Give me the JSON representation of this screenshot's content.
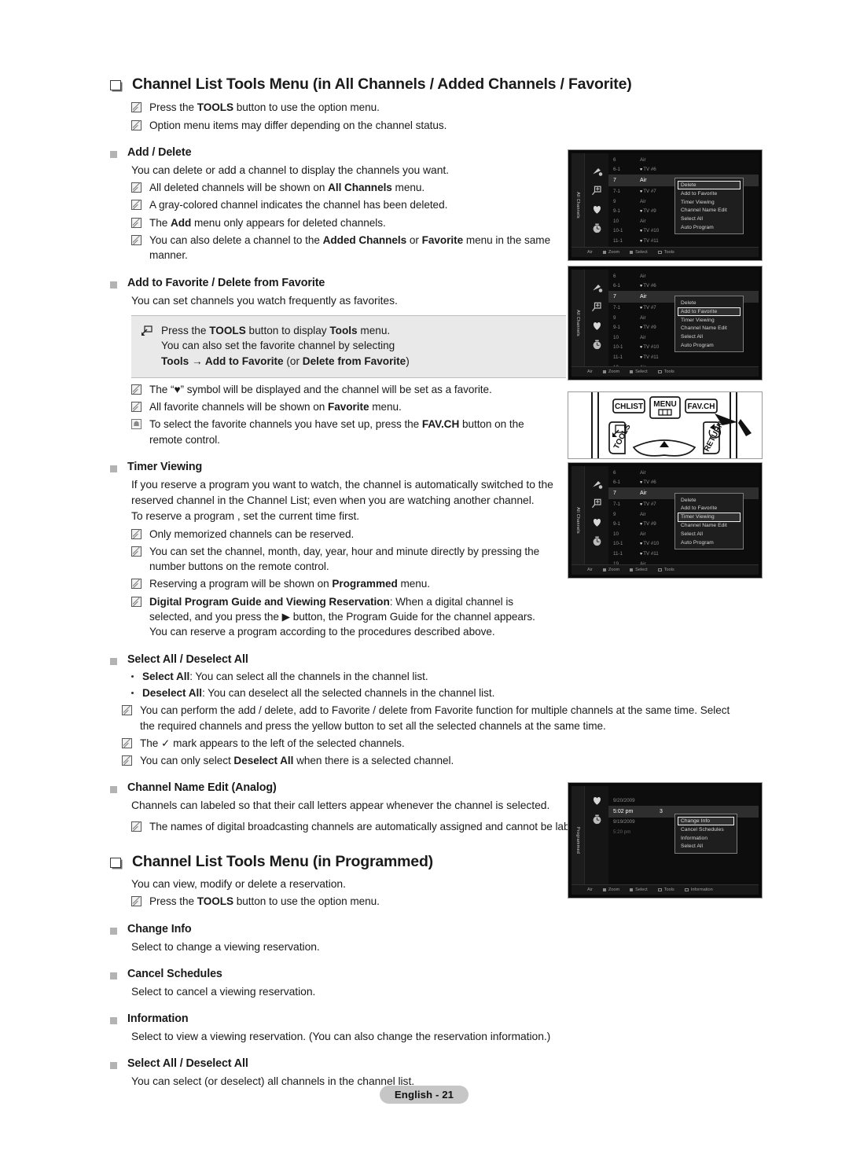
{
  "document": {
    "footer_label": "English - 21"
  },
  "section1": {
    "heading": "Channel List Tools Menu (in All Channels / Added Channels / Favorite)",
    "notes": [
      "Press the TOOLS button to use the option menu.",
      "Option menu items may differ depending on the channel status."
    ],
    "note1_pre": "Press the ",
    "note1_bold": "TOOLS",
    "note1_post": " button to use the option menu.",
    "note2": "Option menu items may differ depending on the channel status."
  },
  "add_delete": {
    "heading": "Add / Delete",
    "intro": "You can delete or add a channel to display the channels you want.",
    "n1_a": "All deleted channels will be shown on ",
    "n1_b": "All Channels",
    "n1_c": " menu.",
    "n2": "A gray-colored channel indicates the channel has been deleted.",
    "n3_a": "The ",
    "n3_b": "Add",
    "n3_c": " menu only appears for deleted channels.",
    "n4_a": "You can also delete a channel to the ",
    "n4_b": "Added Channels",
    "n4_c": " or ",
    "n4_d": "Favorite",
    "n4_e": " menu in the same",
    "n4_f": "manner."
  },
  "favorite": {
    "heading": "Add to Favorite / Delete from Favorite",
    "intro": "You can set channels you watch frequently as favorites.",
    "box_l1_a": "Press the ",
    "box_l1_b": "TOOLS",
    "box_l1_c": " button to display ",
    "box_l1_d": "Tools",
    "box_l1_e": " menu.",
    "box_l2": "You can also set the favorite channel by selecting",
    "box_l3_a": "Tools",
    "box_l3_arrow": " → ",
    "box_l3_b": "Add to Favorite",
    "box_l3_c": " (or ",
    "box_l3_d": "Delete from Favorite",
    "box_l3_e": ")",
    "n1": "The “♥” symbol will be displayed and the channel will be set as a favorite.",
    "n2_a": "All favorite channels will be shown on ",
    "n2_b": "Favorite",
    "n2_c": " menu.",
    "n3_a": "To select the favorite channels you have set up, press the ",
    "n3_b": "FAV.CH",
    "n3_c": " button on the",
    "n3_d": "remote control."
  },
  "timer": {
    "heading": "Timer Viewing",
    "p1": "If you reserve a program you want to watch, the channel is automatically switched to the",
    "p2": "reserved channel in the Channel List; even when you are watching another channel.",
    "p3": "To reserve a program , set the current time first.",
    "n1": "Only memorized channels can be reserved.",
    "n2_a": "You can set the channel, month, day, year, hour and minute directly by pressing the",
    "n2_b": "number buttons on the remote control.",
    "n3_a": "Reserving a program will be shown on ",
    "n3_b": "Programmed",
    "n3_c": " menu.",
    "n4_bold": "Digital Program Guide and Viewing Reservation",
    "n4_a": ": When a digital channel is",
    "n4_b": "selected, and you press the ",
    "n4_arrow": "▶",
    "n4_c": " button, the Program Guide for the channel appears.",
    "n4_d": "You can reserve a program according to the procedures described above."
  },
  "select_all_1": {
    "heading": "Select All / Deselect All",
    "d1_b": "Select All",
    "d1_t": ": You can select all the channels in the channel list.",
    "d2_b": "Deselect All",
    "d2_t": ": You can deselect all the selected channels in the channel list.",
    "n1_a": "You can perform the add / delete, add to Favorite / delete from Favorite function for multiple channels at the same time. Select",
    "n1_b": "the required channels and press the yellow button to set all the selected channels at the same time.",
    "n2_a": "The ",
    "n2_check": "✓",
    "n2_b": " mark appears to the left of the selected channels.",
    "n3_a": "You can only select ",
    "n3_b": "Deselect All",
    "n3_c": " when there is a selected channel."
  },
  "channel_name_edit": {
    "heading": "Channel Name Edit (Analog)",
    "intro": "Channels can labeled so that their call letters appear whenever the channel is selected.",
    "n1": "The names of digital broadcasting channels are automatically assigned and cannot be labeled."
  },
  "section2": {
    "heading": "Channel List Tools Menu (in Programmed)",
    "intro": "You can view, modify or delete a reservation.",
    "n1_a": "Press the ",
    "n1_b": "TOOLS",
    "n1_c": " button to use the option menu."
  },
  "change_info": {
    "heading": "Change Info",
    "text": "Select to change a viewing reservation."
  },
  "cancel_schedules": {
    "heading": "Cancel Schedules",
    "text": "Select to cancel a viewing reservation."
  },
  "information": {
    "heading": "Information",
    "text": "Select to view a viewing reservation. (You can also change the reservation information.)"
  },
  "select_all_2": {
    "heading": "Select All / Deselect All",
    "text": "You can select (or deselect) all channels in the channel list."
  },
  "tv_screens": {
    "rail_label_channels": "All Channels",
    "rail_label_programmed": "Programmed",
    "channel_rows": [
      {
        "num": "6",
        "name": "Air",
        "fav": false,
        "selected": false
      },
      {
        "num": "6-1",
        "name": "TV #6",
        "fav": true,
        "selected": false
      },
      {
        "num": "7",
        "name": "Air",
        "fav": false,
        "selected": true
      },
      {
        "num": "7-1",
        "name": "TV #7",
        "fav": true,
        "selected": false
      },
      {
        "num": "9",
        "name": "Air",
        "fav": false,
        "selected": false
      },
      {
        "num": "9-1",
        "name": "TV #9",
        "fav": true,
        "selected": false
      },
      {
        "num": "10",
        "name": "Air",
        "fav": false,
        "selected": false
      },
      {
        "num": "10-1",
        "name": "TV #10",
        "fav": true,
        "selected": false
      },
      {
        "num": "11-1",
        "name": "TV #11",
        "fav": true,
        "selected": false
      },
      {
        "num": "19",
        "name": "Air",
        "fav": false,
        "selected": false
      }
    ],
    "tools_menu_items": [
      "Delete",
      "Add to Favorite",
      "Timer Viewing",
      "Channel Name Edit",
      "Select All",
      "Auto Program"
    ],
    "shot1_highlight": "Delete",
    "shot2_highlight": "Add to Favorite",
    "shot3_highlight": "Timer Viewing",
    "bottom_bar": [
      "Air",
      "Zoom",
      "Select",
      "Tools"
    ],
    "bottom_bar_programmed": [
      "Air",
      "Zoom",
      "Select",
      "Tools",
      "Information"
    ],
    "programmed_rows": [
      {
        "date": "9/20/2009",
        "time": "",
        "ch": "",
        "selected": false,
        "dim": false
      },
      {
        "date": "",
        "time": "5:02 pm",
        "ch": "3",
        "selected": true,
        "dim": false
      },
      {
        "date": "9/19/2009",
        "time": "",
        "ch": "",
        "selected": false,
        "dim": false
      },
      {
        "date": "",
        "time": "5:20 pm",
        "ch": "",
        "selected": false,
        "dim": true
      }
    ],
    "programmed_menu_items": [
      "Change Info",
      "Cancel Schedules",
      "Information",
      "Select All"
    ],
    "programmed_highlight": "Change Info"
  },
  "remote": {
    "btn_chlist": "CHLIST",
    "btn_menu": "MENU",
    "btn_favch": "FAV.CH",
    "btn_tools": "TOOLS",
    "btn_return": "RETURN"
  },
  "colors": {
    "page_bg": "#ffffff",
    "text": "#1a1a1a",
    "note_box_bg": "#e9e9e9",
    "footer_bg": "#c6c6c6",
    "tv_bg": "#0d0d0d",
    "tv_highlight": "#2f2f2f"
  }
}
